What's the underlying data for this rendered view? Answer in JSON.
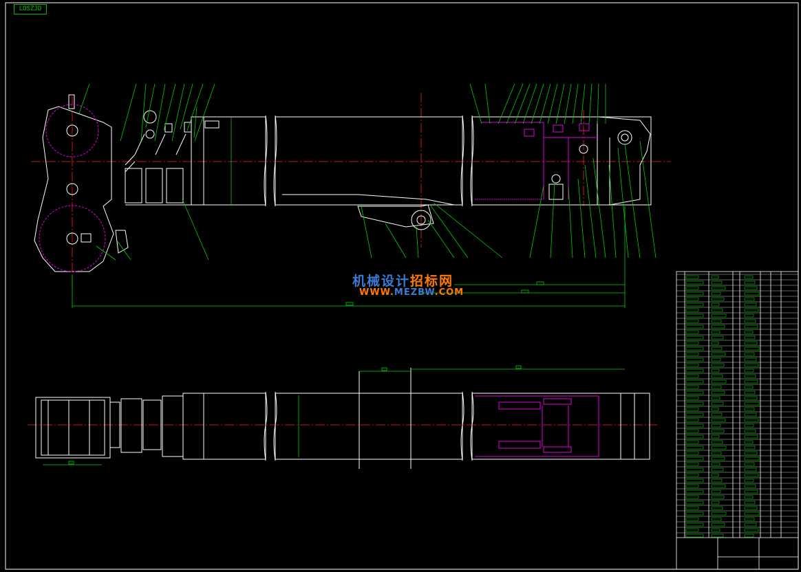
{
  "drawing": {
    "label_tag": "LOSZJD",
    "colors": {
      "background": "#000000",
      "outline": "#ffffff",
      "leader": "#00d000",
      "centerline": "#ff2020",
      "accent": "#e000e0",
      "frame": "#ffffff"
    }
  },
  "watermark": {
    "line1_part1": "机械设计",
    "line1_part2": "招标网",
    "line2_part1": "WWW.",
    "line2_part2": "MEZBW",
    "line2_part3": ".COM",
    "color_blue": "#3a7bd5",
    "color_orange": "#ff7a00"
  },
  "parts_table": {
    "row_count": 48
  }
}
